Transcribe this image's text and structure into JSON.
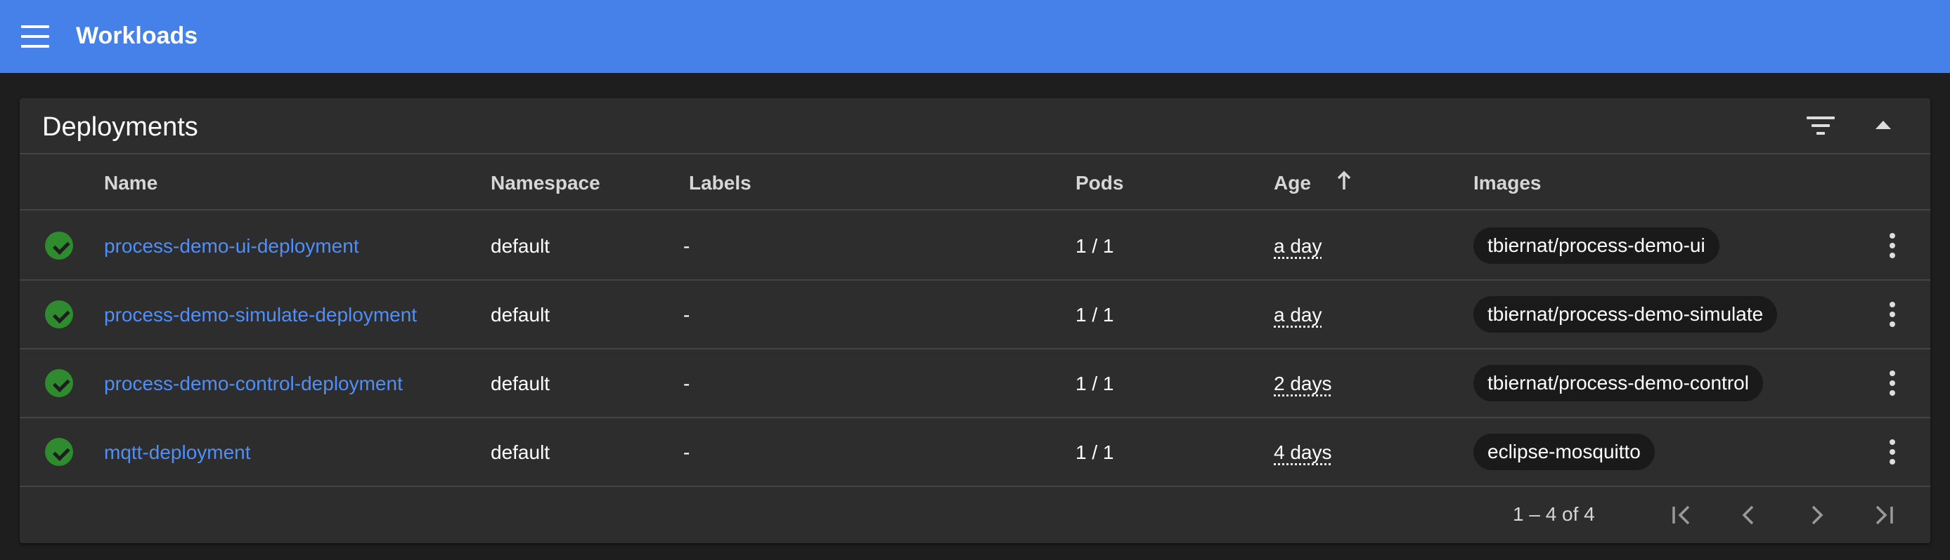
{
  "header": {
    "title": "Workloads",
    "menu_icon": "menu-icon",
    "color": "#4581e9"
  },
  "card": {
    "title": "Deployments",
    "filter_icon": "filter-icon",
    "collapse_icon": "collapse-icon"
  },
  "table": {
    "columns": {
      "name": "Name",
      "namespace": "Namespace",
      "labels": "Labels",
      "pods": "Pods",
      "age": "Age",
      "images": "Images"
    },
    "sort": {
      "column": "Age",
      "direction": "ascending",
      "icon": "arrow-up-icon"
    },
    "rows": [
      {
        "status": "success",
        "name": "process-demo-ui-deployment",
        "namespace": "default",
        "labels": "-",
        "pods": "1 / 1",
        "age": "a day",
        "image": "tbiernat/process-demo-ui"
      },
      {
        "status": "success",
        "name": "process-demo-simulate-deployment",
        "namespace": "default",
        "labels": "-",
        "pods": "1 / 1",
        "age": "a day",
        "image": "tbiernat/process-demo-simulate"
      },
      {
        "status": "success",
        "name": "process-demo-control-deployment",
        "namespace": "default",
        "labels": "-",
        "pods": "1 / 1",
        "age": "2 days",
        "image": "tbiernat/process-demo-control"
      },
      {
        "status": "success",
        "name": "mqtt-deployment",
        "namespace": "default",
        "labels": "-",
        "pods": "1 / 1",
        "age": "4 days",
        "image": "eclipse-mosquitto"
      }
    ]
  },
  "paginator": {
    "range_label": "1 – 4 of 4",
    "buttons": [
      "first-page-icon",
      "previous-page-icon",
      "next-page-icon",
      "last-page-icon"
    ]
  },
  "colors": {
    "link": "#4f8ff7",
    "success": "#2e8b2e",
    "card_bg": "#2d2d2d",
    "page_bg": "#1e1e1e"
  }
}
